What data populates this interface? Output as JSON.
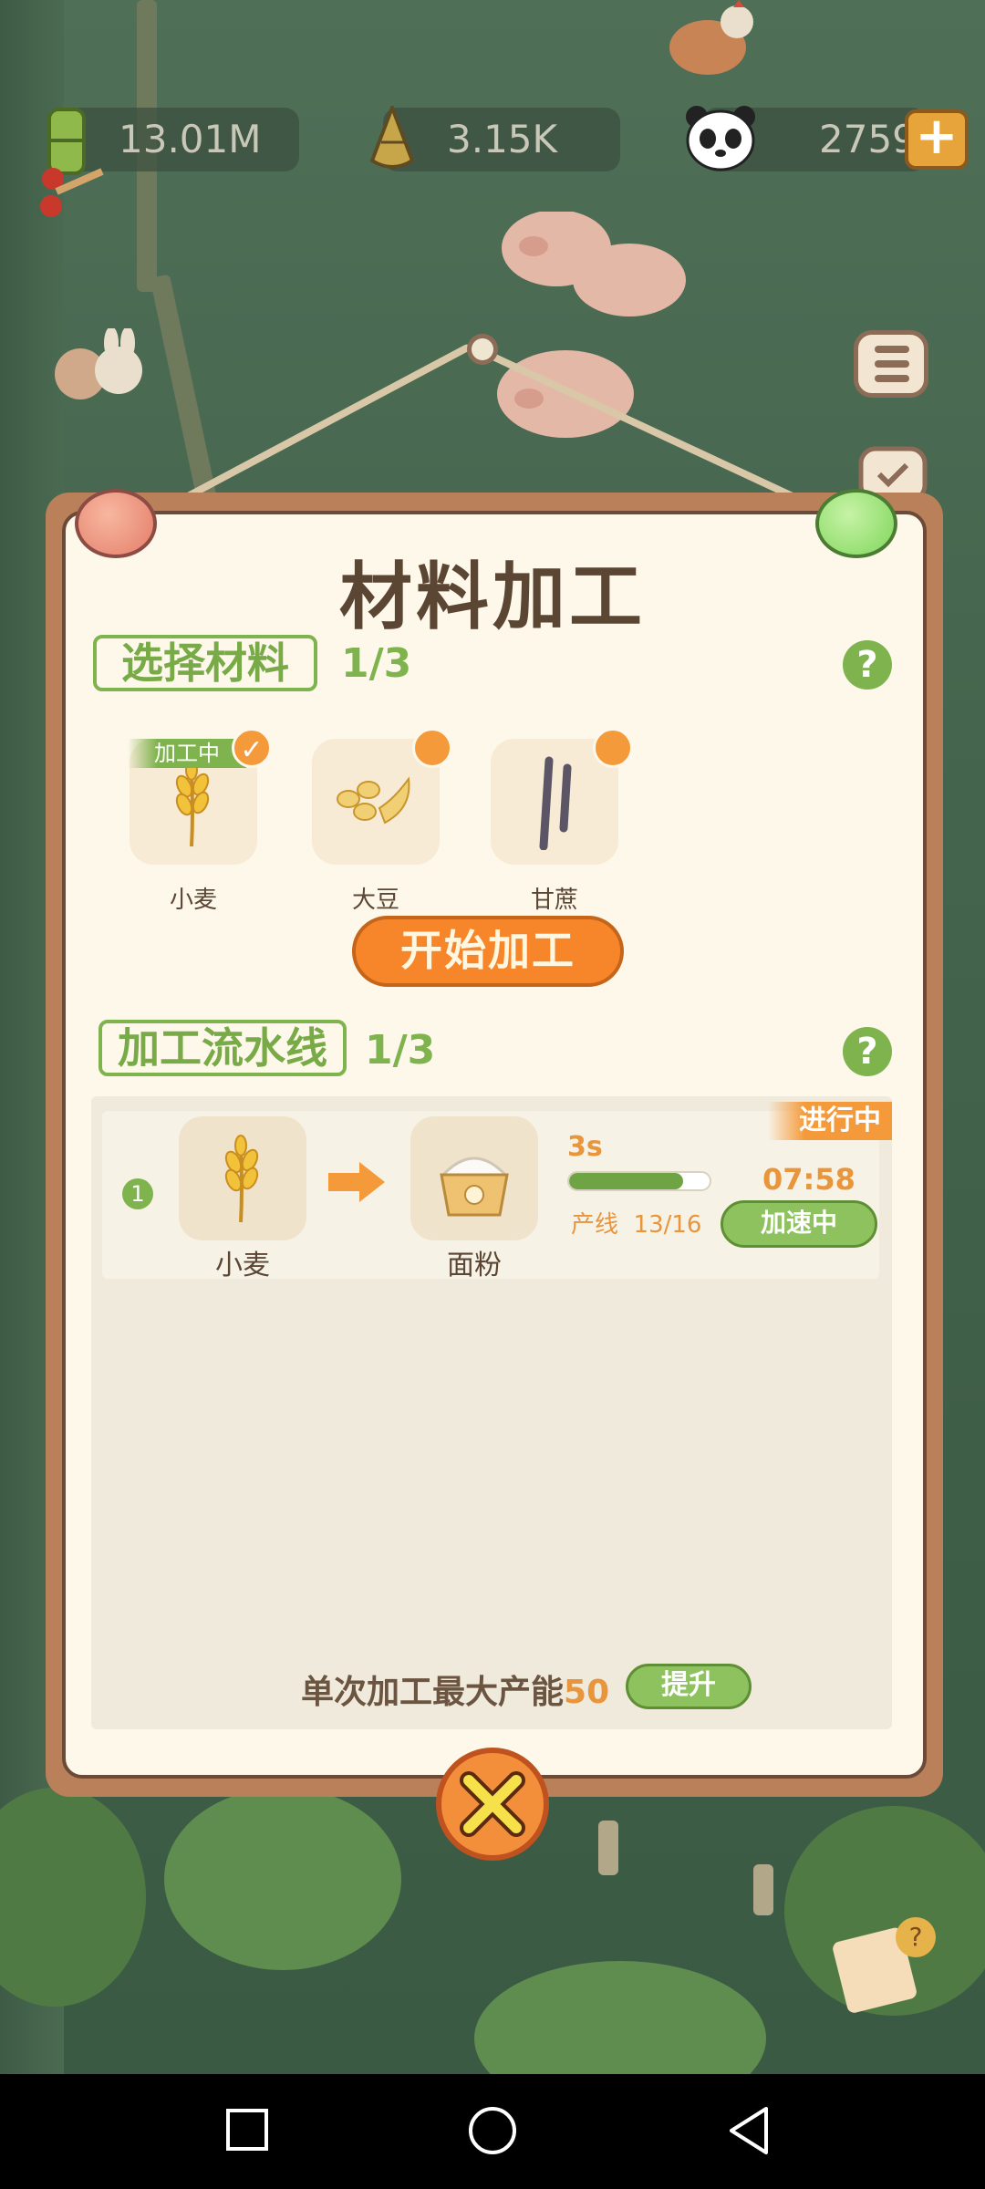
{
  "resources": [
    {
      "icon": "bamboo-icon",
      "value": "13.01M"
    },
    {
      "icon": "bamboo-shoot-icon",
      "value": "3.15K"
    },
    {
      "icon": "panda-icon",
      "value": "2759"
    }
  ],
  "dialog": {
    "title": "材料加工",
    "select_section": {
      "label": "选择材料",
      "count": "1/3",
      "materials": [
        {
          "name": "小麦",
          "icon": "wheat-icon",
          "selected": true,
          "ribbon": "加工中"
        },
        {
          "name": "大豆",
          "icon": "soybean-icon",
          "selected": false
        },
        {
          "name": "甘蔗",
          "icon": "sugarcane-icon",
          "selected": false
        }
      ],
      "start_button": "开始加工"
    },
    "line_section": {
      "label": "加工流水线",
      "count": "1/3",
      "rows": [
        {
          "number": "1",
          "status": "进行中",
          "input": {
            "name": "小麦",
            "icon": "wheat-icon"
          },
          "output": {
            "name": "面粉",
            "icon": "flour-icon"
          },
          "cycle_time": "3s",
          "progress": 0.8125,
          "line_label": "产线",
          "line_count": "13/16",
          "remaining": "07:58",
          "speed_button": "加速中"
        }
      ]
    },
    "capacity_text": "单次加工最大产能",
    "capacity_value": "50",
    "upgrade_button": "提升"
  },
  "colors": {
    "accent_green": "#7fb34e",
    "accent_orange": "#f7862b",
    "panel": "#fdf8ea",
    "text_brown": "#5b4533"
  }
}
